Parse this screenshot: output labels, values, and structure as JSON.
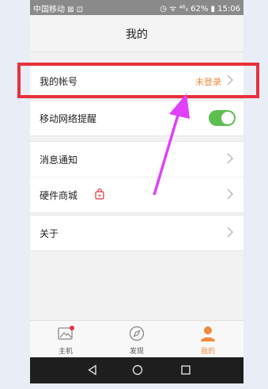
{
  "status_bar": {
    "carrier": "中国移动 ⊠ ⊡",
    "right": "◷ ᯤ ⁴⁶ᵢₗ 62% ▮ 15:06"
  },
  "header": {
    "title": "我的"
  },
  "account": {
    "label": "我的帐号",
    "status": "未登录",
    "status_color": "#f08a3c"
  },
  "network": {
    "label": "移动网络提醒",
    "toggle_on": true,
    "toggle_color": "#5cbf4e"
  },
  "notify": {
    "label": "消息通知"
  },
  "shop": {
    "label": "硬件商城"
  },
  "about": {
    "label": "关于"
  },
  "tabs": [
    {
      "label": "主机",
      "icon": "image-icon"
    },
    {
      "label": "发现",
      "icon": "compass-icon"
    },
    {
      "label": "我的",
      "icon": "person-icon",
      "active": true
    }
  ],
  "colors": {
    "highlight": "#e8303c",
    "arrow": "#e040fb",
    "accent": "#f08a3c"
  }
}
